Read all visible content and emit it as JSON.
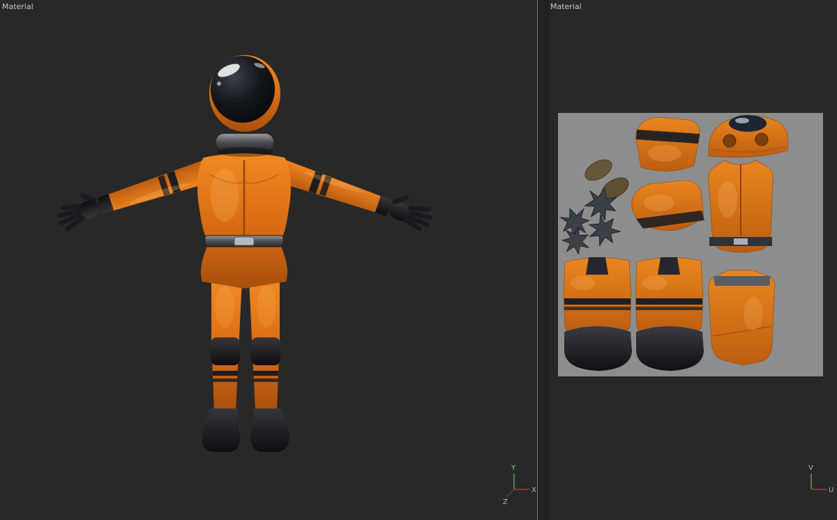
{
  "viewport_3d": {
    "label": "Material",
    "gizmo": {
      "y": {
        "label": "Y",
        "color": "#57a345"
      },
      "x": {
        "label": "X",
        "color": "#a8403a"
      },
      "z": {
        "label": "Z",
        "color": "#474747"
      }
    },
    "model": {
      "suit_color": "#d96a12",
      "trim_color": "#1b1b1e",
      "visor_color": "#0c0d10",
      "metal_color": "#6e6e72"
    }
  },
  "viewport_uv": {
    "label": "Material",
    "canvas_color": "#8d8d8d",
    "gizmo": {
      "v": {
        "label": "V",
        "color": "#57a345"
      },
      "u": {
        "label": "U",
        "color": "#a8403a"
      }
    }
  }
}
